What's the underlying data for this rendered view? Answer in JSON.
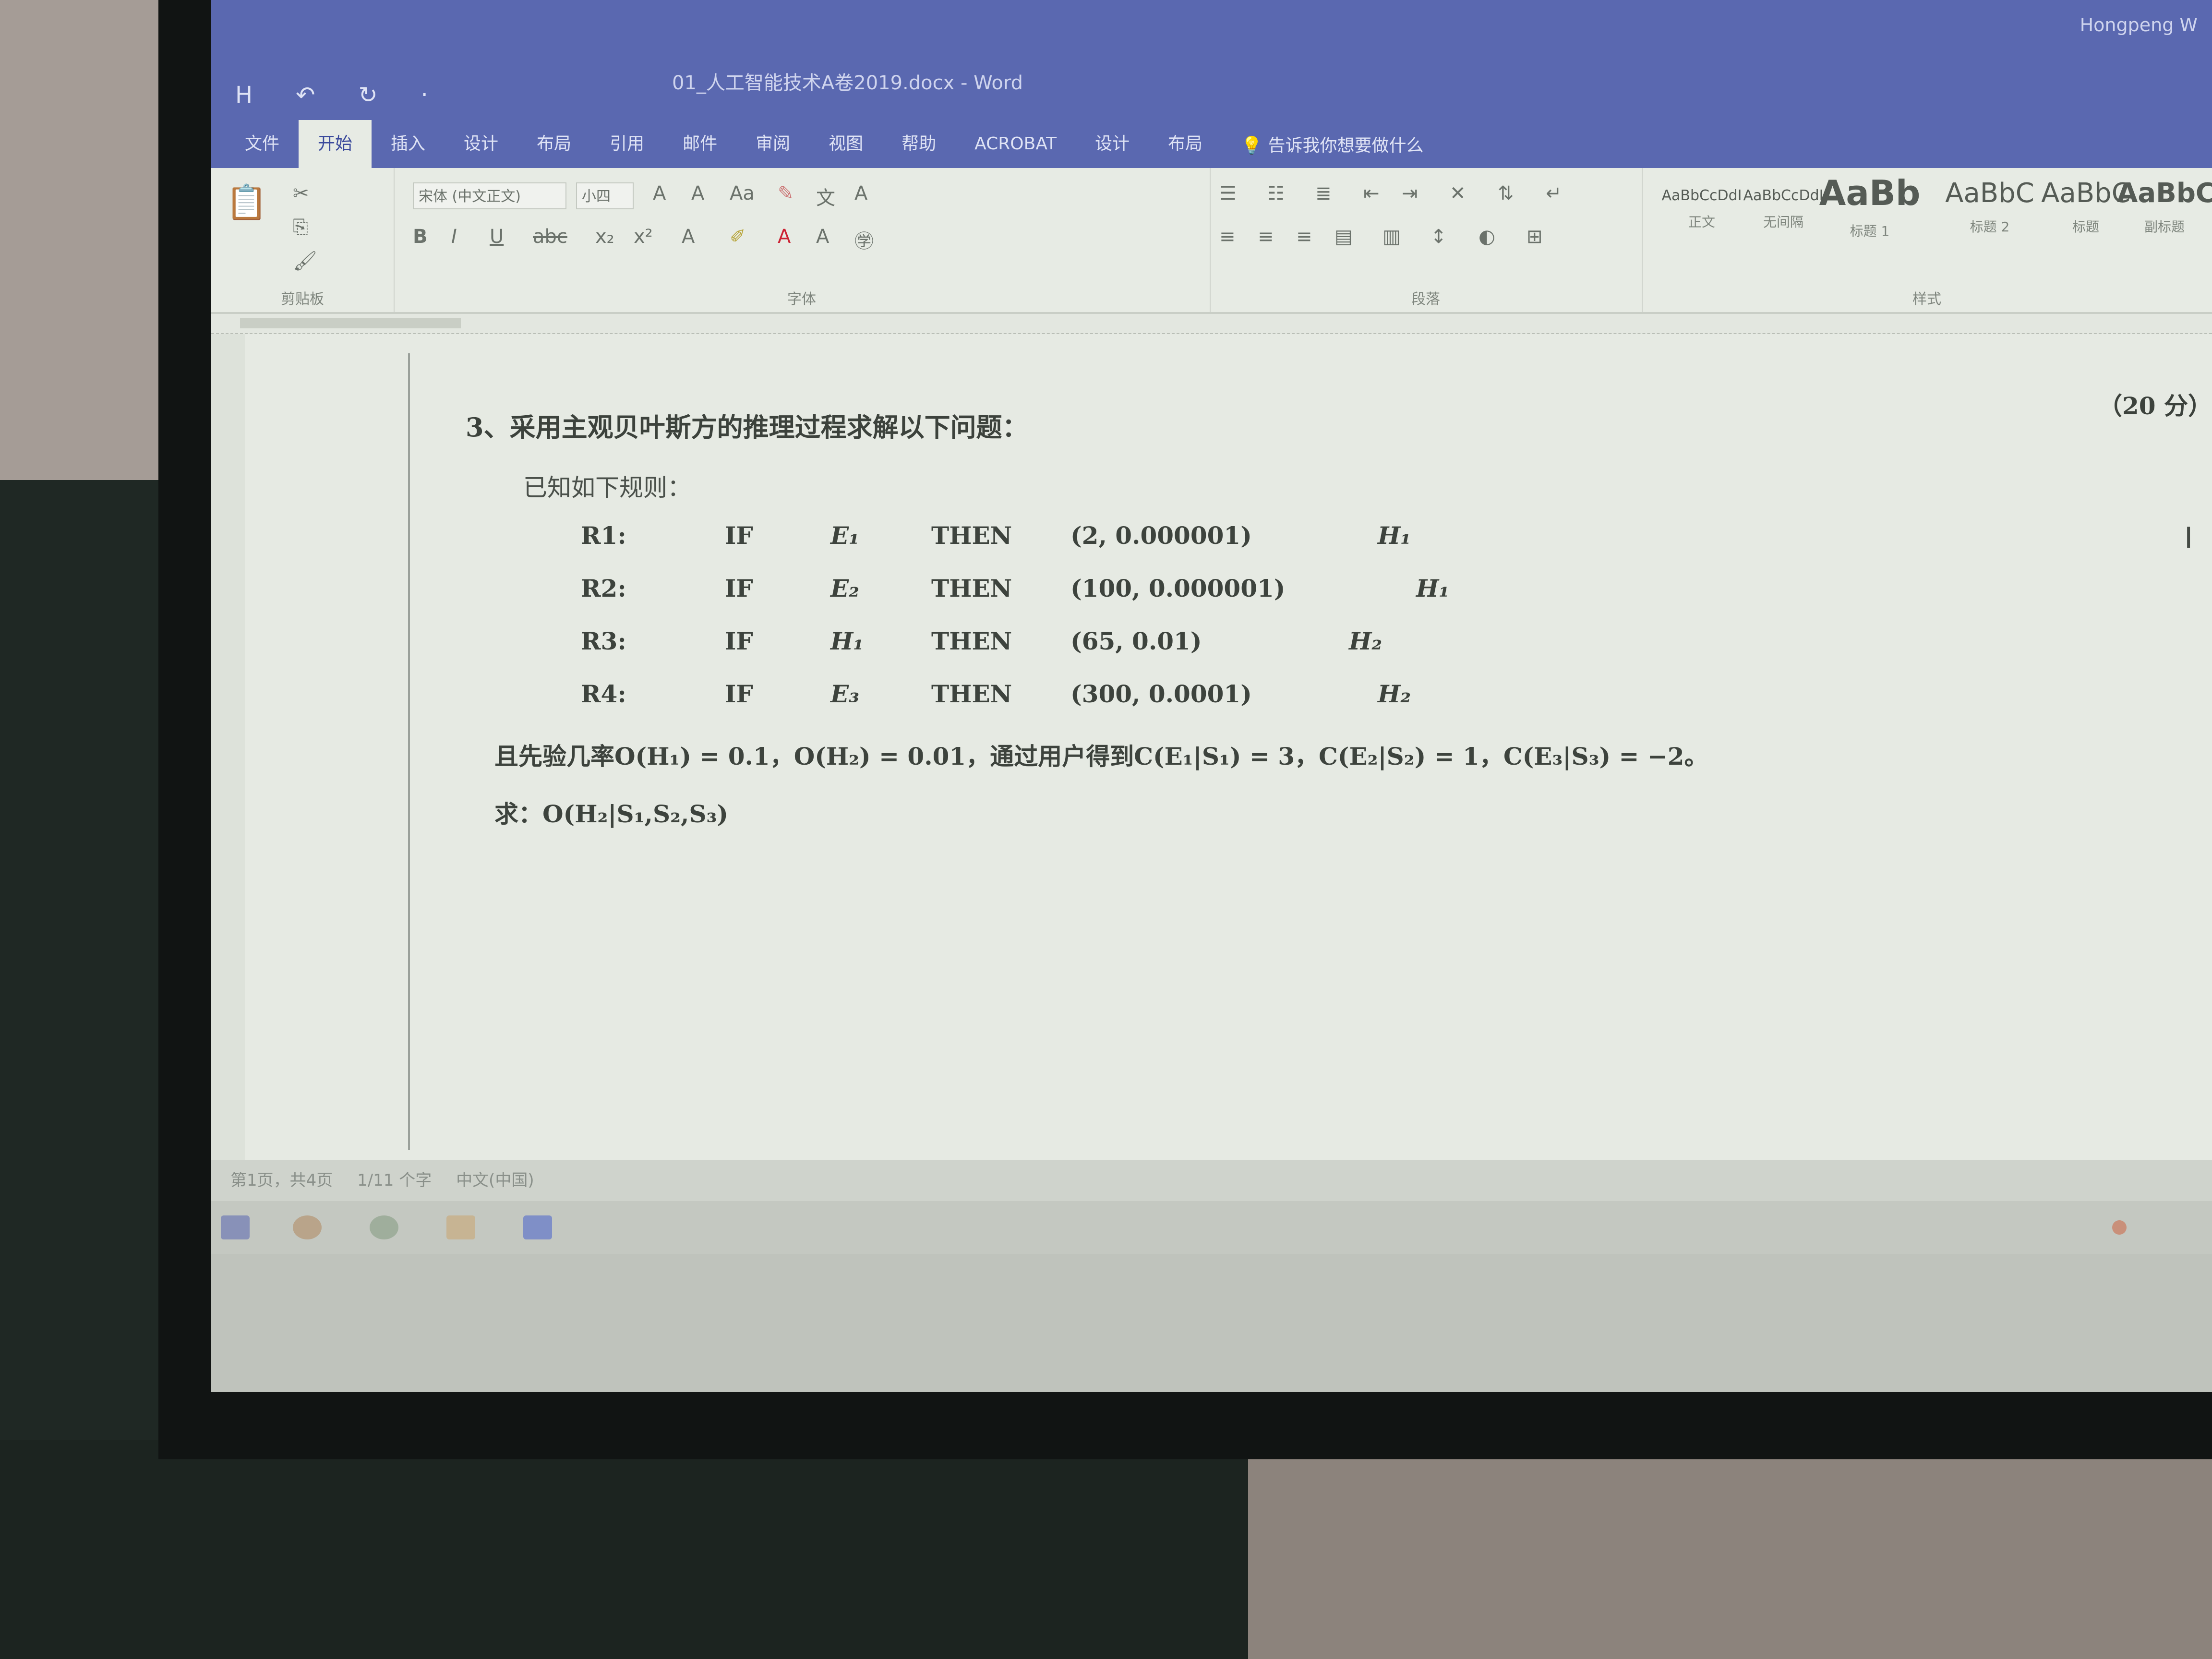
{
  "app": {
    "title": "01_人工智能技术A卷2019.docx - Word",
    "user": "Hongpeng W"
  },
  "qat": [
    "H",
    "↶",
    "↻",
    "·"
  ],
  "tabs": [
    "文件",
    "开始",
    "插入",
    "设计",
    "布局",
    "引用",
    "邮件",
    "审阅",
    "视图",
    "帮助",
    "ACROBAT",
    "设计",
    "布局"
  ],
  "active_tab": "开始",
  "tell_me": "告诉我你想要做什么",
  "ribbon": {
    "font_name": "宋体 (中文正文)",
    "font_size": "小四",
    "groups": [
      "剪贴板",
      "字体",
      "段落",
      "样式"
    ],
    "styles": [
      {
        "preview": "AaBbCcDdI",
        "name": "正文"
      },
      {
        "preview": "AaBbCcDdI",
        "name": "无间隔"
      },
      {
        "preview": "AaBb",
        "name": "标题 1"
      },
      {
        "preview": "AaBbC",
        "name": "标题 2"
      },
      {
        "preview": "AaBbC",
        "name": "标题"
      },
      {
        "preview": "AaBbC",
        "name": "副标题"
      }
    ]
  },
  "document": {
    "question": "3、采用主观贝叶斯方的推理过程求解以下问题：",
    "points": "（20 分）",
    "known": "已知如下规则：",
    "rules": [
      {
        "id": "R1:",
        "if": "IF",
        "evidence": "E₁",
        "then": "THEN",
        "values": "(2,  0.000001)",
        "hypothesis": "H₁"
      },
      {
        "id": "R2:",
        "if": "IF",
        "evidence": "E₂",
        "then": "THEN",
        "values": "(100,  0.000001)",
        "hypothesis": "H₁"
      },
      {
        "id": "R3:",
        "if": "IF",
        "evidence": "H₁",
        "then": "THEN",
        "values": "(65,  0.01)",
        "hypothesis": "H₂"
      },
      {
        "id": "R4:",
        "if": "IF",
        "evidence": "E₃",
        "then": "THEN",
        "values": "(300,  0.0001)",
        "hypothesis": "H₂"
      }
    ],
    "prior": "且先验几率O(H₁) = 0.1，O(H₂) = 0.01，通过用户得到C(E₁|S₁) = 3，C(E₂|S₂) = 1，C(E₃|S₃) = −2。",
    "ask": "求：O(H₂|S₁,S₂,S₃)"
  },
  "statusbar": [
    "第1页，共4页",
    "1/11 个字",
    "中文(中国)"
  ]
}
